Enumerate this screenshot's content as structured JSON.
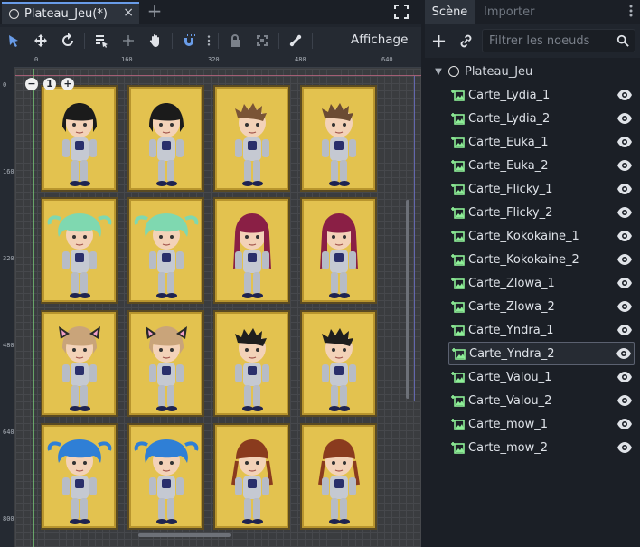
{
  "editor": {
    "tab_title": "Plateau_Jeu(*)",
    "tab_close": "×",
    "tab_add": "+",
    "view_menu": "Affichage",
    "ruler_top": [
      "0",
      "160",
      "320",
      "480",
      "640"
    ],
    "ruler_left": [
      "0",
      "160",
      "320",
      "480",
      "640",
      "800"
    ],
    "zoom_out": "−",
    "zoom_reset": "1",
    "zoom_in": "+"
  },
  "cards": [
    {
      "hair": "#1b1b1b",
      "style": "bob"
    },
    {
      "hair": "#1b1b1b",
      "style": "bob"
    },
    {
      "hair": "#7a5436",
      "style": "spiky"
    },
    {
      "hair": "#6b4b33",
      "style": "spiky"
    },
    {
      "hair": "#7fd8b0",
      "style": "fluffy"
    },
    {
      "hair": "#7fd8b0",
      "style": "fluffy"
    },
    {
      "hair": "#8a1f45",
      "style": "long"
    },
    {
      "hair": "#8a1f45",
      "style": "long"
    },
    {
      "hair": "#c9a47a",
      "style": "catear"
    },
    {
      "hair": "#c9a47a",
      "style": "catear"
    },
    {
      "hair": "#1e1e1e",
      "style": "spiky"
    },
    {
      "hair": "#1e1e1e",
      "style": "spiky"
    },
    {
      "hair": "#2f7fd6",
      "style": "fluffy"
    },
    {
      "hair": "#2f7fd6",
      "style": "fluffy"
    },
    {
      "hair": "#8a3b1e",
      "style": "braid"
    },
    {
      "hair": "#8a3b1e",
      "style": "braid"
    }
  ],
  "dock": {
    "tab_scene": "Scène",
    "tab_import": "Importer",
    "filter_placeholder": "Filtrer les noeuds",
    "root_label": "Plateau_Jeu",
    "nodes": [
      "Carte_Lydia_1",
      "Carte_Lydia_2",
      "Carte_Euka_1",
      "Carte_Euka_2",
      "Carte_Flicky_1",
      "Carte_Flicky_2",
      "Carte_Kokokaine_1",
      "Carte_Kokokaine_2",
      "Carte_Zlowa_1",
      "Carte_Zlowa_2",
      "Carte_Yndra_1",
      "Carte_Yndra_2",
      "Carte_Valou_1",
      "Carte_Valou_2",
      "Carte_mow_1",
      "Carte_mow_2"
    ],
    "selected_node": "Carte_Yndra_2"
  },
  "colors": {
    "accent": "#699ce8",
    "node_icon": "#8eef97",
    "card_bg": "#e3c24f"
  }
}
